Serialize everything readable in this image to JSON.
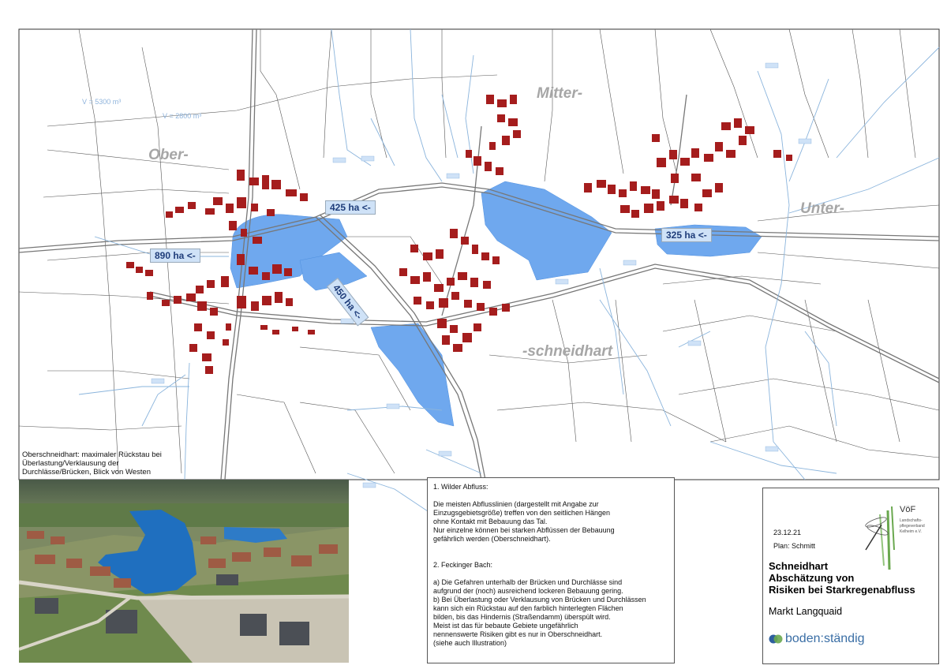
{
  "places": {
    "ober": "Ober-",
    "mitter": "Mitter-",
    "unter": "Unter-",
    "schneidhart": "-schneidhart"
  },
  "volumes": {
    "v1": "V = 5300 m³",
    "v2": "V = 2800 m³"
  },
  "flow_labels": {
    "f890": "890 ha <-",
    "f425": "425 ha <-",
    "f450": "450 ha <-",
    "f325": "325 ha <-"
  },
  "photo_caption": "Oberschneidhart: maximaler Rückstau bei Überlastung/Verklausung der Durchlässe/Brücken, Blick von Westen",
  "textbox": {
    "h1": "1. Wilder Abfluss:",
    "p1": [
      "Die meisten Abflusslinien (dargestellt mit Angabe zur",
      " Einzugsgebietsgröße) treffen von den seitlichen Hängen",
      "ohne Kontakt mit Bebauung das Tal.",
      "Nur einzelne können bei starken Abflüssen der Bebauung",
      " gefährlich werden (Oberschneidhart)."
    ],
    "h2": "2. Feckinger Bach:",
    "p2": [
      "a) Die Gefahren unterhalb der Brücken und Durchlässe sind",
      "aufgrund der (noch) ausreichend lockeren Bebauung gering.",
      "b) Bei Überlastung oder Verklausung von Brücken und Durchlässen",
      "kann sich ein Rückstau auf den farblich hinterlegten Flächen",
      "bilden, bis das Hindernis (Straßendamm) überspült wird.",
      "Meist ist das für bebaute Gebiete ungefährlich",
      "nennenswerte Risiken gibt es nur in Oberschneidhart.",
      "(siehe auch Illustration)"
    ]
  },
  "titlebox": {
    "date": "23.12.21",
    "plan": "Plan:  Schmitt",
    "title": [
      "Schneidhart",
      "Abschätzung von",
      "Risiken bei Starkregenabfluss"
    ],
    "municipality": "Markt Langquaid",
    "brand": "boden:ständig",
    "logo_text": "VöF"
  },
  "colors": {
    "water": "#6fa8ee",
    "building": "#a51d1d",
    "stream": "#8ab4dc",
    "road": "#777777"
  }
}
